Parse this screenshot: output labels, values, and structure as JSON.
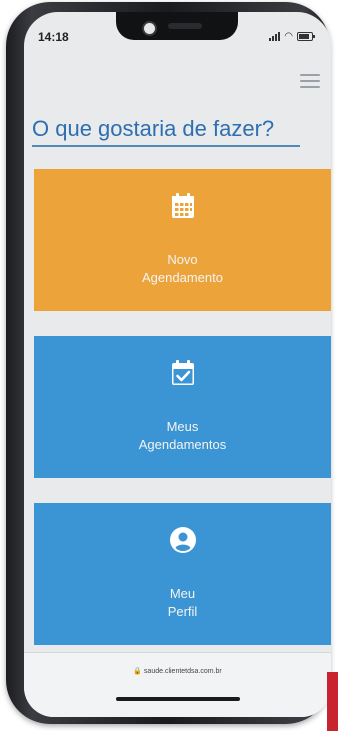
{
  "status_bar": {
    "time": "14:18"
  },
  "header": {
    "menu_icon": "hamburger-menu-icon"
  },
  "page": {
    "title": "O que gostaria de fazer?"
  },
  "actions": [
    {
      "icon": "calendar-grid-icon",
      "line1": "Novo",
      "line2": "Agendamento",
      "color": "#eca43a"
    },
    {
      "icon": "calendar-check-icon",
      "line1": "Meus",
      "line2": "Agendamentos",
      "color": "#3b94d3"
    },
    {
      "icon": "user-circle-icon",
      "line1": "Meu",
      "line2": "Perfil",
      "color": "#3b94d3"
    }
  ],
  "browser": {
    "url": "saude.clientetdsa.com.br",
    "lock_icon": "lock-icon"
  },
  "colors": {
    "accent": "#2d6fb0",
    "orange": "#eca43a",
    "blue": "#3b94d3",
    "red_accent": "#c8242f"
  }
}
